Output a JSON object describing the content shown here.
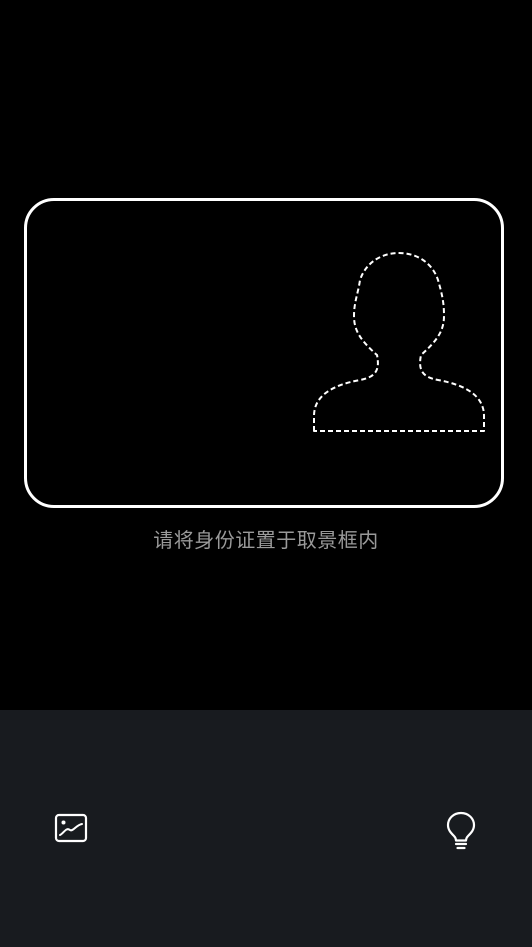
{
  "scanner": {
    "hint_text": "请将身份证置于取景框内"
  },
  "toolbar": {
    "gallery_icon": "image-gallery-icon",
    "flash_icon": "lightbulb-icon"
  },
  "colors": {
    "background": "#000000",
    "frame_border": "#ffffff",
    "hint_text": "#9a9a9a",
    "toolbar_background": "#181b1f",
    "icon": "#ffffff"
  }
}
